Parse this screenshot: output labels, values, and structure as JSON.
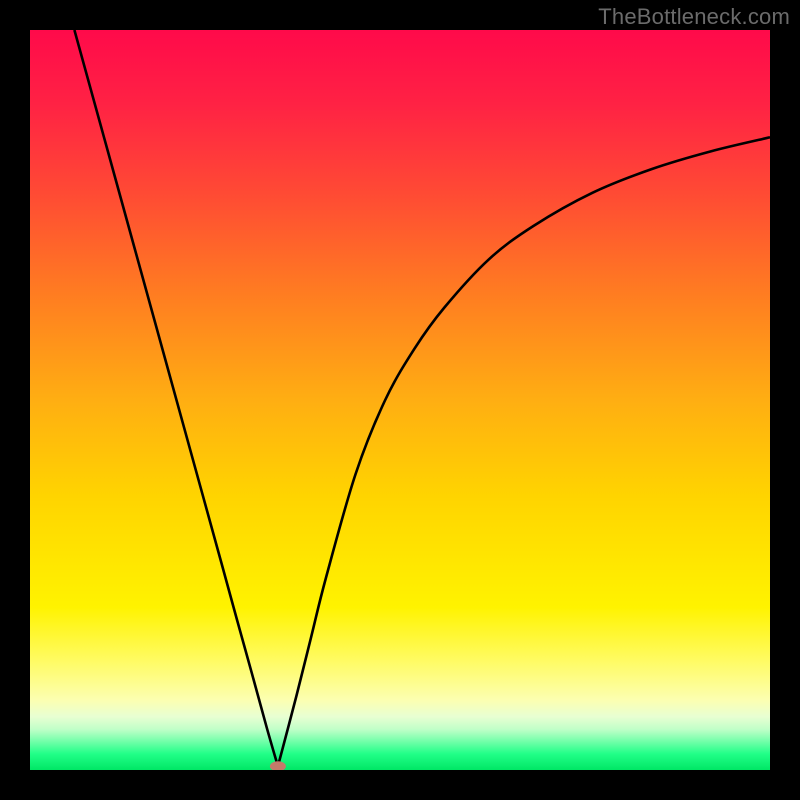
{
  "watermark": "TheBottleneck.com",
  "chart_data": {
    "type": "line",
    "title": "",
    "xlabel": "",
    "ylabel": "",
    "xlim": [
      0,
      100
    ],
    "ylim": [
      0,
      100
    ],
    "grid": false,
    "series": [
      {
        "name": "left-branch",
        "x": [
          6,
          10,
          14,
          18,
          22,
          26,
          28,
          30,
          32,
          33.5
        ],
        "values": [
          100,
          85.5,
          71,
          56.5,
          42,
          27.5,
          20.2,
          13,
          5.7,
          0.5
        ]
      },
      {
        "name": "right-branch",
        "x": [
          33.5,
          36,
          38,
          40,
          44,
          48,
          52,
          56,
          62,
          68,
          76,
          84,
          92,
          100
        ],
        "values": [
          0.5,
          10,
          18,
          26,
          40,
          50,
          57,
          62.5,
          69,
          73.5,
          78,
          81.2,
          83.6,
          85.5
        ]
      }
    ],
    "markers": [
      {
        "name": "min-marker",
        "x": 33.5,
        "y": 0.5
      }
    ],
    "gradient_stops": [
      {
        "offset": 0.0,
        "color": "#ff0a4a"
      },
      {
        "offset": 0.1,
        "color": "#ff2244"
      },
      {
        "offset": 0.22,
        "color": "#ff4a34"
      },
      {
        "offset": 0.35,
        "color": "#ff7a22"
      },
      {
        "offset": 0.5,
        "color": "#ffae12"
      },
      {
        "offset": 0.63,
        "color": "#ffd400"
      },
      {
        "offset": 0.78,
        "color": "#fff300"
      },
      {
        "offset": 0.85,
        "color": "#fffb60"
      },
      {
        "offset": 0.905,
        "color": "#fcffb0"
      },
      {
        "offset": 0.928,
        "color": "#e8ffd2"
      },
      {
        "offset": 0.945,
        "color": "#c0ffc8"
      },
      {
        "offset": 0.962,
        "color": "#6fffa8"
      },
      {
        "offset": 0.978,
        "color": "#22ff88"
      },
      {
        "offset": 1.0,
        "color": "#00e765"
      }
    ],
    "marker_color": "#c47a6a",
    "curve_color": "#000000"
  }
}
